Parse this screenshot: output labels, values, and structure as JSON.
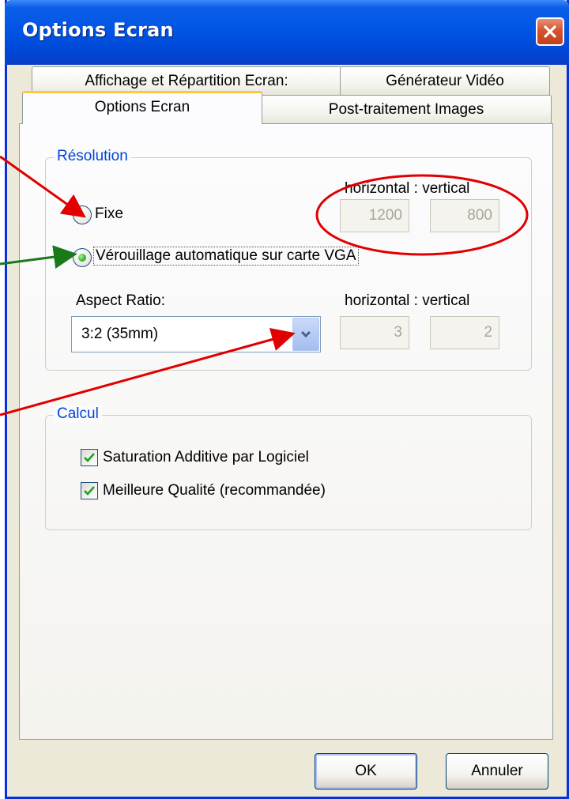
{
  "window": {
    "title": "Options Ecran"
  },
  "tabs": {
    "back_row": [
      {
        "label": "Affichage et Répartition Ecran:"
      },
      {
        "label": "Générateur Vidéo"
      }
    ],
    "front_row": [
      {
        "label": "Options Ecran",
        "active": true
      },
      {
        "label": "Post-traitement Images"
      }
    ]
  },
  "resolution": {
    "group_label": "Résolution",
    "header": "horizontal : vertical",
    "fixed_label": "Fixe",
    "fixed_selected": false,
    "fixed_horizontal": "1200",
    "fixed_vertical": "800",
    "auto_label": "Vérouillage automatique sur carte VGA",
    "auto_selected": true,
    "aspect_label": "Aspect Ratio:",
    "aspect_header": "horizontal : vertical",
    "aspect_value": "3:2 (35mm)",
    "aspect_horizontal": "3",
    "aspect_vertical": "2"
  },
  "calcul": {
    "group_label": "Calcul",
    "options": [
      {
        "label": "Saturation Additive par Logiciel",
        "checked": true
      },
      {
        "label": "Meilleure Qualité (recommandée)",
        "checked": true
      }
    ]
  },
  "buttons": {
    "ok": "OK",
    "cancel": "Annuler"
  },
  "icons": {
    "close": "close-icon",
    "dropdown": "chevron-down-icon",
    "check": "check-icon"
  },
  "colors": {
    "titlebar": "#0054e3",
    "group_label": "#0046d5",
    "annotation_red": "#e00000",
    "annotation_green": "#1a7a1a",
    "active_tab_accent": "#ffc83c"
  }
}
